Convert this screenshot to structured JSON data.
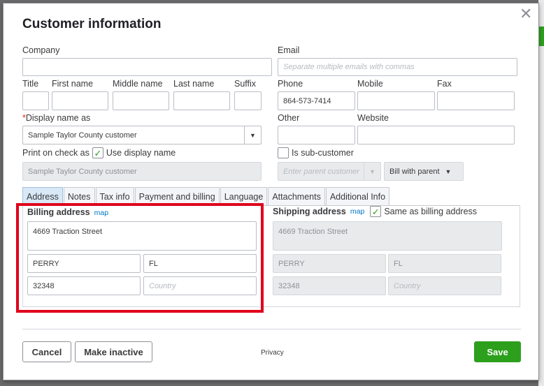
{
  "dialog": {
    "title": "Customer information"
  },
  "labels": {
    "company": "Company",
    "email": "Email",
    "title": "Title",
    "first_name": "First name",
    "middle_name": "Middle name",
    "last_name": "Last name",
    "suffix": "Suffix",
    "phone": "Phone",
    "mobile": "Mobile",
    "fax": "Fax",
    "display_name": "Display name as",
    "other": "Other",
    "website": "Website",
    "print_on_check": "Print on check as",
    "use_display_name": "Use display name",
    "is_sub_customer": "Is sub-customer"
  },
  "values": {
    "company": "",
    "email_placeholder": "Separate multiple emails with commas",
    "phone": "864-573-7414",
    "display_name": "Sample Taylor County customer",
    "print_on_check": "Sample Taylor County customer",
    "parent_customer_placeholder": "Enter parent customer",
    "bill_with": "Bill with parent",
    "use_display_name_checked": true,
    "is_sub_customer_checked": false
  },
  "tabs": [
    "Address",
    "Notes",
    "Tax info",
    "Payment and billing",
    "Language",
    "Attachments",
    "Additional Info"
  ],
  "billing": {
    "heading": "Billing address",
    "map": "map",
    "street": "4669  Traction Street",
    "city": "PERRY",
    "state": "FL",
    "zip": "32348",
    "country_placeholder": "Country"
  },
  "shipping": {
    "heading": "Shipping address",
    "map": "map",
    "same_as_billing": "Same as billing address",
    "same_checked": true,
    "street": "4669  Traction Street",
    "city": "PERRY",
    "state": "FL",
    "zip": "32348",
    "country_placeholder": "Country"
  },
  "footer": {
    "cancel": "Cancel",
    "make_inactive": "Make inactive",
    "privacy": "Privacy",
    "save": "Save"
  },
  "icons": {
    "close": "close-icon",
    "dropdown": "chevron-down-icon",
    "check": "checkmark-icon"
  },
  "colors": {
    "accent": "#2ca01c",
    "link": "#0077c5",
    "highlight": "#e0001b",
    "required": "#d52b1e"
  }
}
